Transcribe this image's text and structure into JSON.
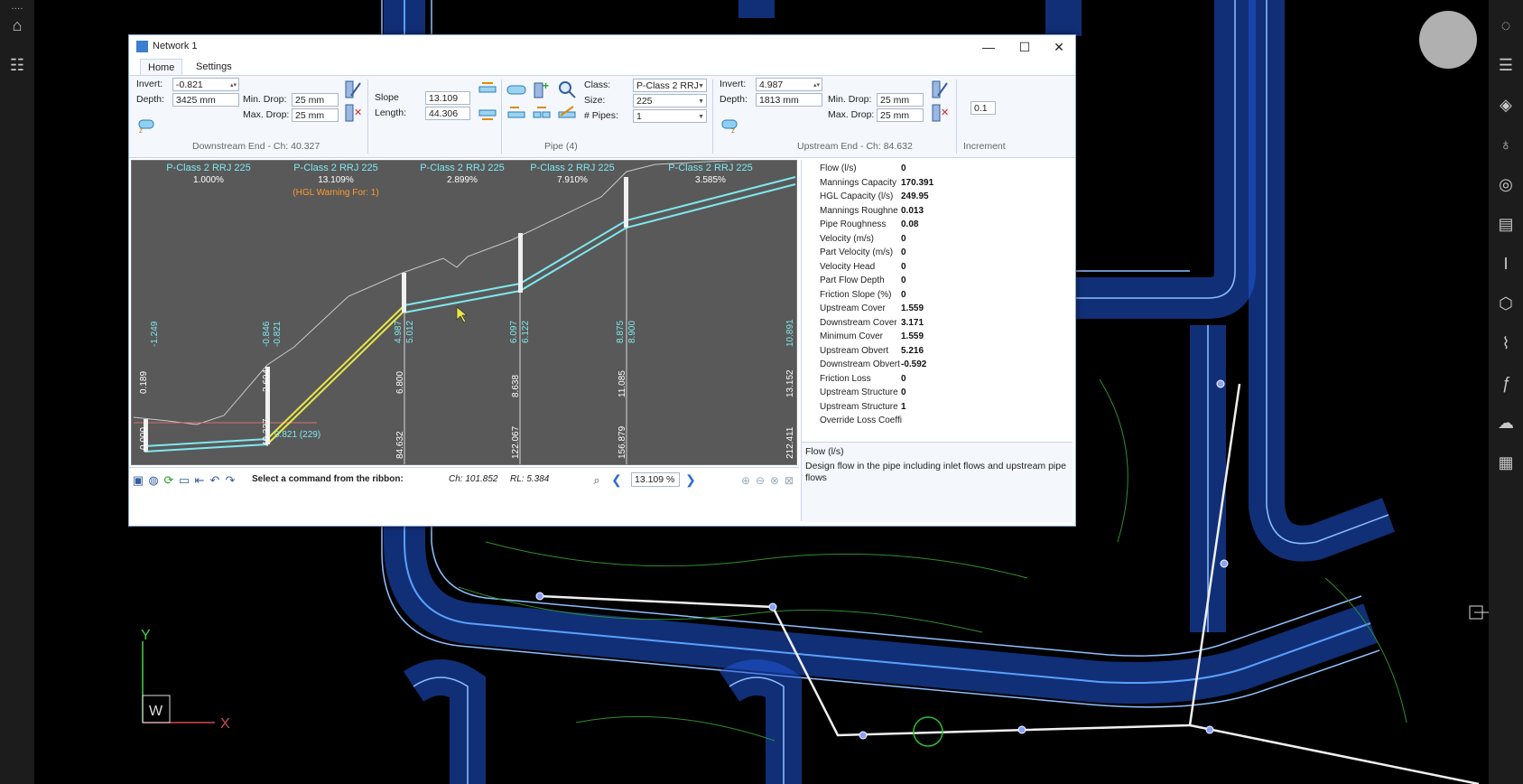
{
  "window": {
    "title": "Network 1",
    "min": "—",
    "max": "☐",
    "close": "✕"
  },
  "tabs": [
    {
      "label": "Home"
    },
    {
      "label": "Settings"
    }
  ],
  "downstream": {
    "invert_label": "Invert:",
    "invert": "-0.821",
    "depth_label": "Depth:",
    "depth": "3425 mm",
    "min_drop_label": "Min. Drop:",
    "min_drop": "25 mm",
    "max_drop_label": "Max. Drop:",
    "max_drop": "25 mm",
    "group": "Downstream End  -  Ch: 40.327"
  },
  "pipe": {
    "slope_label": "Slope",
    "slope": "13.109",
    "length_label": "Length:",
    "length": "44.306",
    "class_label": "Class:",
    "class": "P-Class 2 RRJ",
    "size_label": "Size:",
    "size": "225",
    "pipes_label": "# Pipes:",
    "pipes": "1",
    "group": "Pipe (4)"
  },
  "upstream": {
    "invert_label": "Invert:",
    "invert": "4.987",
    "depth_label": "Depth:",
    "depth": "1813 mm",
    "min_drop_label": "Min. Drop:",
    "min_drop": "25 mm",
    "max_drop_label": "Max. Drop:",
    "max_drop": "25 mm",
    "group": "Upstream End  -  Ch: 84.632"
  },
  "increment": {
    "value": "0.1",
    "group": "Increment"
  },
  "profile": {
    "pipe_labels": [
      {
        "name": "P-Class 2 RRJ 225",
        "slope": "1.000%"
      },
      {
        "name": "P-Class 2 RRJ 225",
        "slope": "13.109%"
      },
      {
        "name": "P-Class 2 RRJ 225",
        "slope": "2.899%"
      },
      {
        "name": "P-Class 2 RRJ 225",
        "slope": "7.910%"
      },
      {
        "name": "P-Class 2 RRJ 225",
        "slope": "3.585%"
      }
    ],
    "warning": "(HGL Warning For: 1)",
    "inverts": [
      "-1.249",
      "-0.846",
      "-0.821",
      "4.987",
      "5.012",
      "6.097",
      "6.122",
      "8.875",
      "8.900",
      "10.891"
    ],
    "depths": [
      "0.189",
      "2.604",
      "6.800",
      "8.638",
      "11.085",
      "13.152"
    ],
    "chainages": [
      "0.000",
      "40.327",
      "84.632",
      "122.067",
      "156.879",
      "212.411"
    ],
    "node_label": "0.821 (229)"
  },
  "properties": [
    {
      "k": "Flow (l/s)",
      "v": "0"
    },
    {
      "k": "Mannings Capacity",
      "v": "170.391"
    },
    {
      "k": "HGL Capacity (l/s)",
      "v": "249.95"
    },
    {
      "k": "Mannings Roughne",
      "v": "0.013"
    },
    {
      "k": "Pipe Roughness",
      "v": "0.08"
    },
    {
      "k": "Velocity (m/s)",
      "v": "0"
    },
    {
      "k": "Part Velocity (m/s)",
      "v": "0"
    },
    {
      "k": "Velocity Head",
      "v": "0"
    },
    {
      "k": "Part Flow Depth",
      "v": "0"
    },
    {
      "k": "Friction Slope (%)",
      "v": "0"
    },
    {
      "k": "Upstream Cover",
      "v": "1.559"
    },
    {
      "k": "Downstream Cover",
      "v": "3.171"
    },
    {
      "k": "Minimum Cover",
      "v": "1.559"
    },
    {
      "k": "Upstream Obvert",
      "v": "5.216"
    },
    {
      "k": "Downstream Obvert",
      "v": "-0.592"
    },
    {
      "k": "Friction Loss",
      "v": "0"
    },
    {
      "k": "Upstream Structure",
      "v": "0"
    },
    {
      "k": "Upstream Structure",
      "v": "1"
    },
    {
      "k": "Override Loss Coeffi",
      "v": ""
    }
  ],
  "help": {
    "title": "Flow (l/s)",
    "text": "Design flow in the pipe including inlet flows and upstream pipe flows"
  },
  "status": {
    "command": "Select a command from the ribbon:",
    "ch": "Ch: 101.852",
    "rl": "RL: 5.384",
    "zoom": "13.109 %"
  },
  "ucs": {
    "y": "Y",
    "x": "X",
    "w": "W"
  },
  "colors": {
    "cad_bg": "#000000",
    "road_blue": "#2a6cff",
    "profile_pipe": "#7fe8ee",
    "selected_pipe": "#e8e84a",
    "warning": "#ff9a2e"
  }
}
